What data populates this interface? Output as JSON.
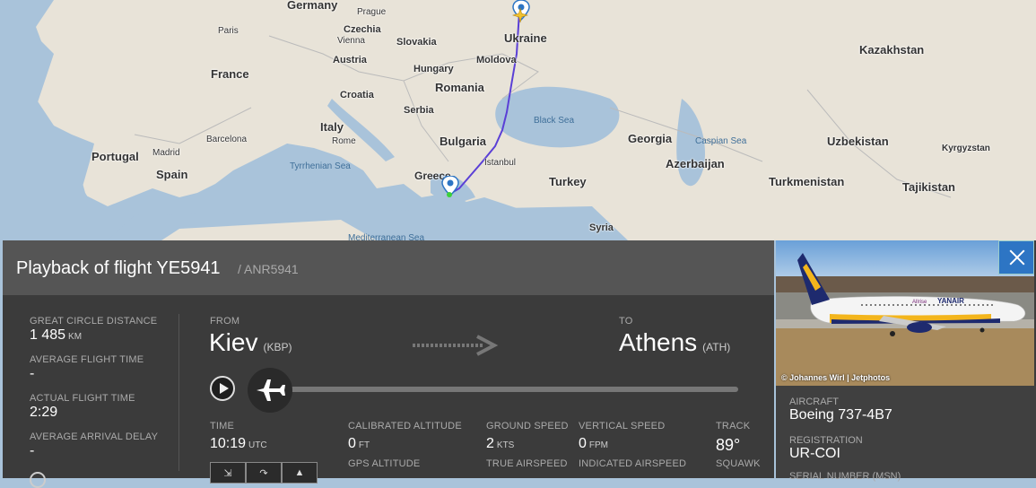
{
  "map": {
    "countries": [
      "Germany",
      "Czechia",
      "Slovakia",
      "Austria",
      "Hungary",
      "Ukraine",
      "Moldova",
      "Romania",
      "France",
      "Croatia",
      "Serbia",
      "Italy",
      "Bulgaria",
      "Portugal",
      "Spain",
      "Greece",
      "Turkey",
      "Georgia",
      "Azerbaijan",
      "Kazakhstan",
      "Uzbekistan",
      "Turkmenistan",
      "Kyrgyzstan",
      "Tajikistan",
      "Syria"
    ],
    "cities": [
      "Paris",
      "Prague",
      "Vienna",
      "Barcelona",
      "Rome",
      "Madrid",
      "Istanbul"
    ],
    "seas": [
      "Black Sea",
      "Tyrrhenian Sea",
      "Mediterranean Sea",
      "Caspian Sea"
    ]
  },
  "flight": {
    "title": "Playback of flight YE5941",
    "callsign": "/ ANR5941",
    "stats": [
      {
        "label": "GREAT CIRCLE DISTANCE",
        "value": "1 485",
        "unit": "KM"
      },
      {
        "label": "AVERAGE FLIGHT TIME",
        "value": "-",
        "unit": ""
      },
      {
        "label": "ACTUAL FLIGHT TIME",
        "value": "2:29",
        "unit": ""
      },
      {
        "label": "AVERAGE ARRIVAL DELAY",
        "value": "-",
        "unit": ""
      }
    ],
    "from_label": "FROM",
    "from_city": "Kiev",
    "from_code": "(KBP)",
    "to_label": "TO",
    "to_city": "Athens",
    "to_code": "(ATH)",
    "time_label": "TIME",
    "time_value": "10:19",
    "time_unit": "UTC",
    "cal_alt_label": "CALIBRATED ALTITUDE",
    "cal_alt_value": "0",
    "cal_alt_unit": "FT",
    "gps_alt_label": "GPS ALTITUDE",
    "ground_speed_label": "GROUND SPEED",
    "ground_speed_value": "2",
    "ground_speed_unit": "KTS",
    "true_airspeed_label": "TRUE AIRSPEED",
    "vertical_speed_label": "VERTICAL SPEED",
    "vertical_speed_value": "0",
    "vertical_speed_unit": "FPM",
    "indicated_airspeed_label": "INDICATED AIRSPEED",
    "track_label": "TRACK",
    "track_value": "89°",
    "squawk_label": "SQUAWK",
    "playback_progress": 0
  },
  "aircraft": {
    "photo_credit": "© Johannes Wirl | Jetphotos",
    "aircraft_label": "AIRCRAFT",
    "aircraft_value": "Boeing 737-4B7",
    "registration_label": "REGISTRATION",
    "registration_value": "UR-COI",
    "serial_label": "SERIAL NUMBER (MSN)"
  },
  "colors": {
    "route": "#5a3fd6",
    "panel": "#3b3b3b",
    "accent": "#2d75c4"
  },
  "icons": [
    "play-icon",
    "airplane-icon",
    "arrow-right-icon",
    "close-icon",
    "tool-collapse-icon",
    "tool-route-icon",
    "tool-chart-icon"
  ]
}
